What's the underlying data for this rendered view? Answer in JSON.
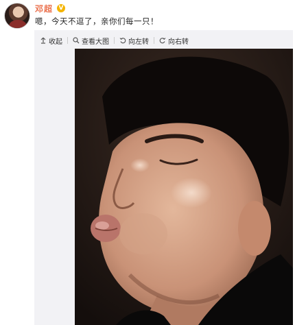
{
  "post": {
    "username": "邓超",
    "verified_badge": "V",
    "text": "嗯，今天不逗了，亲你们每一只！"
  },
  "toolbar": {
    "collapse_label": "收起",
    "view_large_label": "查看大图",
    "rotate_left_label": "向左转",
    "rotate_right_label": "向右转"
  },
  "colors": {
    "username": "#eb7350",
    "verified_badge": "#f4b400",
    "media_background": "#f2f2f5"
  },
  "icons": {
    "collapse": "collapse-up-icon",
    "view_large": "magnify-icon",
    "rotate_left": "rotate-left-icon",
    "rotate_right": "rotate-right-icon"
  }
}
